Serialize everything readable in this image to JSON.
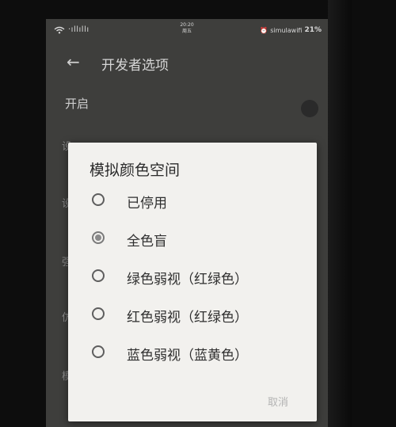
{
  "status_bar": {
    "signal_text": "·ıllıllı",
    "time": "20:20",
    "weekday": "周五",
    "network_name": "simulawifi",
    "battery": "21%"
  },
  "app_bar": {
    "title": "开发者选项"
  },
  "settings": {
    "enable_label": "开启"
  },
  "dialog": {
    "title": "模拟颜色空间",
    "options": [
      {
        "label": "已停用"
      },
      {
        "label": "全色盲"
      },
      {
        "label": "绿色弱视（红绿色）"
      },
      {
        "label": "红色弱视（红绿色）"
      },
      {
        "label": "蓝色弱视（蓝黄色）"
      }
    ],
    "selected_option": "全色盲",
    "cancel_label": "取消"
  }
}
